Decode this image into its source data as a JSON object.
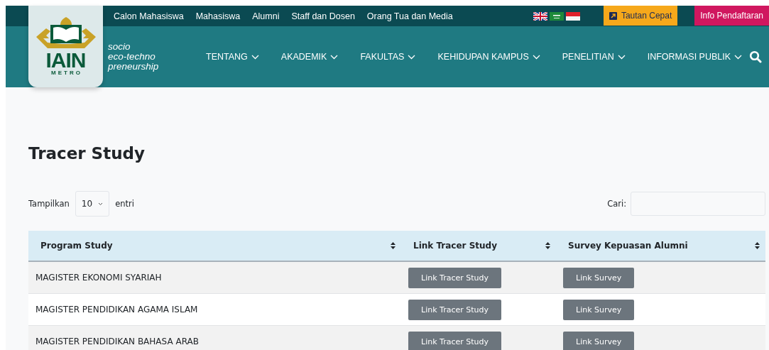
{
  "top_bar": {
    "links": [
      "Calon Mahasiswa",
      "Mahasiswa",
      "Alumni",
      "Staff dan Dosen",
      "Orang Tua dan Media"
    ],
    "buttons": [
      {
        "label": "Tautan Cepat",
        "kind": "quick"
      },
      {
        "label": "Info Pendaftaran",
        "kind": "register"
      }
    ]
  },
  "logo": {
    "name": "IAIN",
    "sub": "METRO"
  },
  "tagline": [
    "socio",
    "eco-techno",
    "preneurship"
  ],
  "nav": [
    "TENTANG",
    "AKADEMIK",
    "FAKULTAS",
    "KEHIDUPAN KAMPUS",
    "PENELITIAN",
    "INFORMASI PUBLIK"
  ],
  "page_title": "Tracer Study",
  "length": {
    "label": "Tampilkan",
    "value": "10",
    "suffix": "entri"
  },
  "search": {
    "label": "Cari:"
  },
  "table": {
    "columns": [
      "Program Study",
      "Link Tracer Study",
      "Survey Kepuasan Alumni"
    ],
    "rows": [
      {
        "program": "MAGISTER EKONOMI SYARIAH",
        "tracer": "Link Tracer Study",
        "survey": "Link Survey"
      },
      {
        "program": "MAGISTER PENDIDIKAN AGAMA ISLAM",
        "tracer": "Link Tracer Study",
        "survey": "Link Survey"
      },
      {
        "program": "MAGISTER PENDIDIKAN BAHASA ARAB",
        "tracer": "Link Tracer Study",
        "survey": "Link Survey"
      }
    ]
  }
}
